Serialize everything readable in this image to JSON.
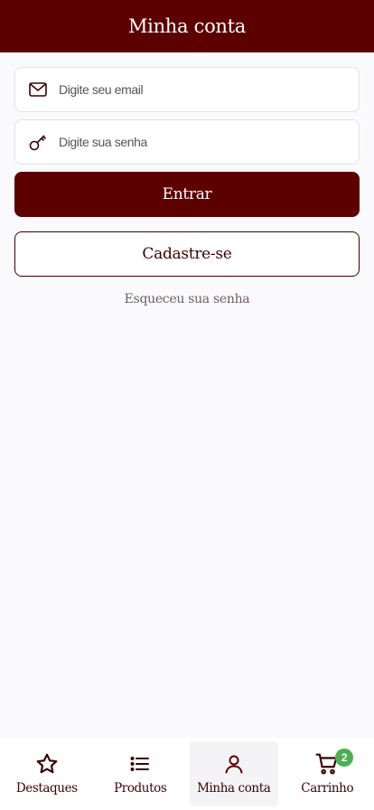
{
  "header": {
    "title": "Minha conta"
  },
  "login_form": {
    "email": {
      "value": "",
      "placeholder": "Digite seu email",
      "icon": "envelope-icon"
    },
    "password": {
      "value": "",
      "placeholder": "Digite sua senha",
      "icon": "key-icon"
    },
    "submit_label": "Entrar",
    "register_label": "Cadastre-se",
    "forgot_label": "Esqueceu sua senha"
  },
  "tabbar": {
    "active": "Minha conta",
    "items": [
      {
        "label": "Destaques",
        "icon": "star-icon"
      },
      {
        "label": "Produtos",
        "icon": "list-icon"
      },
      {
        "label": "Minha conta",
        "icon": "user-icon"
      },
      {
        "label": "Carrinho",
        "icon": "cart-icon",
        "badge": "2"
      }
    ]
  },
  "colors": {
    "brand": "#5c0000",
    "text": "#3d0000",
    "badge": "#4caf50",
    "background": "#fafafc"
  }
}
